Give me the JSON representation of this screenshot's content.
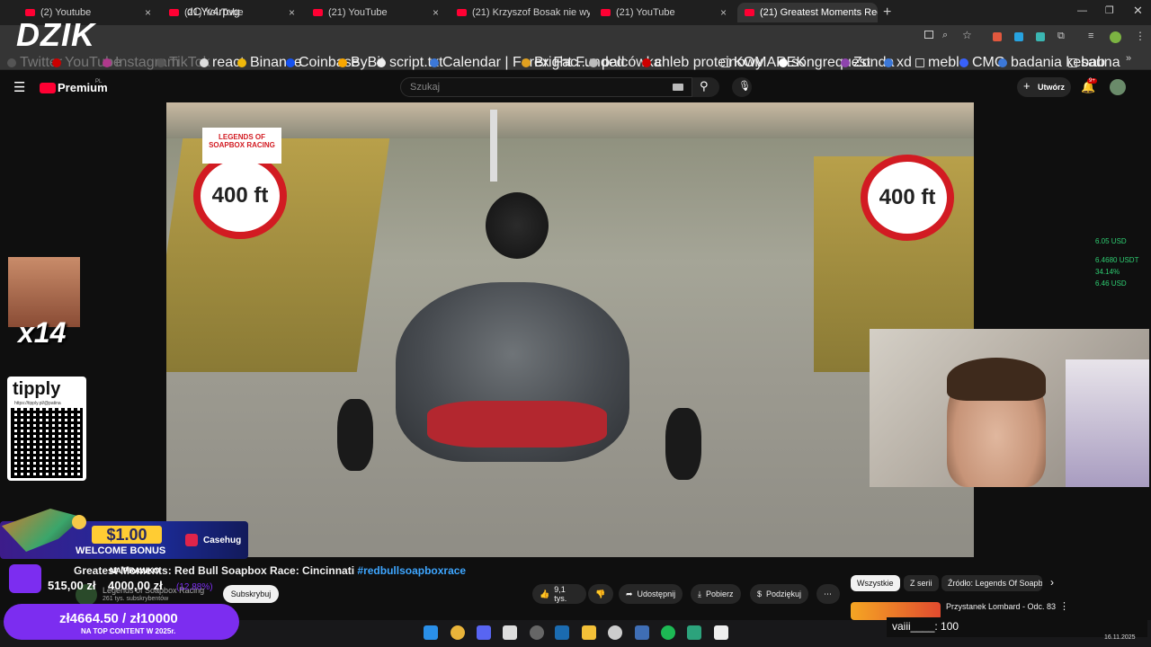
{
  "overlay": {
    "logo": "DZIK",
    "emote_count": "x14",
    "tipply_title": "tipply",
    "tipply_url": "https://tipply.pl/@patina",
    "prices": [
      "6.05 USD",
      "6.4680 USDT",
      "34.14%",
      "6.46 USD"
    ],
    "casino_amount": "$1.00",
    "casino_text": "WELCOME BONUS",
    "casino_brand": "Casehug",
    "stat_title": "NA PRAWKO",
    "stat_left": "515,00 zł",
    "stat_right": "4000,00 zł",
    "stat_pct": "(12,88%)",
    "goal_amount": "zł4664.50 / zł10000",
    "goal_sub": "NA TOP CONTENT W 2025r."
  },
  "browser": {
    "tabs": [
      {
        "label": "(2) Youtube"
      },
      {
        "label": "(21) YouTube"
      },
      {
        "label": "(21) YouTube"
      },
      {
        "label": "(21) Krzyszof Bosak nie wytrzym"
      },
      {
        "label": "(21) YouTube"
      },
      {
        "label": "(21) Greatest Moments Red"
      }
    ],
    "url": "dCYv4rpvg",
    "bookmarks": [
      "Twitter",
      "YouTube",
      "Instagram",
      "TikTok",
      "react",
      "Binance",
      "Coinbase",
      "ByBit",
      "script.txt",
      "Calendar | Forex Fac...",
      "Bright Funded",
      "palcówka",
      "chleb proteinowy",
      "KOMAREK",
      "songrequest",
      "Zonda",
      "xd",
      "meble",
      "CMC",
      "badania kebab",
      "sauna"
    ]
  },
  "youtube": {
    "brand": "Premium",
    "brand_region": "PL",
    "search_placeholder": "Szukaj",
    "create_label": "Utwórz",
    "notif_count": "9+",
    "video": {
      "sign_left": "400 ft",
      "sign_right": "400 ft",
      "sign_left_logo": "LEGENDS OF SOAPBOX RACING"
    },
    "title_text": "Greatest Moments: Red Bull Soapbox Race: Cincinnati ",
    "title_tag": "#redbullsoapboxrace",
    "channel_name": "Legends of Soapbox Racing",
    "channel_subs": "261 tys. subskrybentów",
    "subscribe_label": "Subskrybuj",
    "like_count": "9,1 tys.",
    "share_label": "Udostępnij",
    "download_label": "Pobierz",
    "thanks_label": "Podziękuj",
    "chips": [
      "Wszystkie",
      "Z serii",
      "Źródło: Legends Of Soapbo"
    ],
    "rec_title": "Przystanek Lombard - Odc. 83"
  },
  "chat": {
    "line": "vaiii____: 100"
  },
  "clock": "16.11.2025"
}
